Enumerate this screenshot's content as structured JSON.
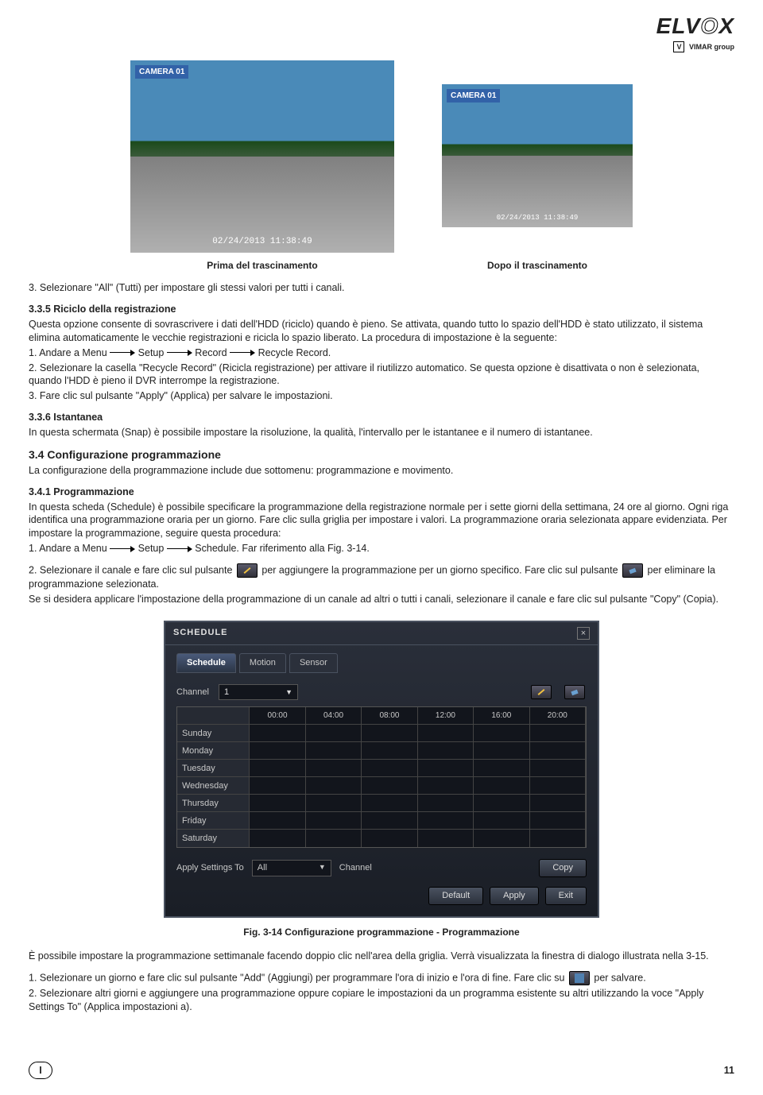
{
  "logo": {
    "main_a": "ELV",
    "main_o": "O",
    "main_b": "X",
    "sub_box": "V",
    "sub": "VIMAR group"
  },
  "camera": {
    "tag": "CAMERA 01",
    "ts": "02/24/2013  11:38:49",
    "cap_before": "Prima del trascinamento",
    "cap_after": "Dopo il trascinamento"
  },
  "p3": "3. Selezionare \"All\" (Tutti) per impostare gli stessi valori per tutti i canali.",
  "s335": {
    "title": "3.3.5 Riciclo della registrazione",
    "p1": "Questa opzione consente di sovrascrivere i dati dell'HDD (riciclo) quando è pieno. Se attivata, quando tutto lo spazio dell'HDD è stato utilizzato, il sistema elimina automaticamente le vecchie registrazioni e ricicla lo spazio liberato. La procedura di impostazione è la seguente:",
    "step1_a": "1. Andare a Menu",
    "step1_b": "Setup",
    "step1_c": "Record",
    "step1_d": "Recycle Record.",
    "step2": "2. Selezionare la casella \"Recycle Record\" (Ricicla registrazione) per attivare il riutilizzo automatico. Se questa opzione è disattivata o non è selezionata, quando l'HDD è pieno il DVR interrompe la registrazione.",
    "step3": "3. Fare clic sul pulsante \"Apply\" (Applica) per salvare le impostazioni."
  },
  "s336": {
    "title": "3.3.6 Istantanea",
    "p": "In questa schermata (Snap) è possibile impostare la risoluzione, la qualità, l'intervallo per le istantanee e il numero di istantanee."
  },
  "s34": {
    "title": "3.4  Configurazione programmazione",
    "p": "La configurazione della programmazione include due sottomenu: programmazione e movimento."
  },
  "s341": {
    "title": "3.4.1 Programmazione",
    "p1": "In questa scheda (Schedule) è possibile specificare la programmazione della registrazione normale per i sette giorni della settimana, 24 ore al giorno. Ogni riga identifica una programmazione oraria per un giorno. Fare clic sulla griglia per impostare i valori. La programmazione oraria selezionata appare evidenziata. Per impostare la programmazione, seguire questa procedura:",
    "step1_a": "1. Andare a Menu",
    "step1_b": "Setup",
    "step1_c": "Schedule. Far riferimento alla Fig. 3-14.",
    "step2_a": "2. Selezionare il canale e fare clic sul pulsante",
    "step2_b": "per aggiungere la programmazione per un giorno specifico. Fare clic sul pulsante",
    "step2_c": "per eliminare la programmazione selezionata.",
    "step2_d": "Se si desidera applicare l'impostazione della programmazione di un canale ad altri o tutti i canali, selezionare il canale e fare clic sul pulsante \"Copy\" (Copia)."
  },
  "sched": {
    "title": "SCHEDULE",
    "tabs": [
      "Schedule",
      "Motion",
      "Sensor"
    ],
    "channel_label": "Channel",
    "channel_val": "1",
    "hours": [
      "00:00",
      "04:00",
      "08:00",
      "12:00",
      "16:00",
      "20:00"
    ],
    "days": [
      "Sunday",
      "Monday",
      "Tuesday",
      "Wednesday",
      "Thursday",
      "Friday",
      "Saturday"
    ],
    "apply_label": "Apply Settings To",
    "apply_val": "All",
    "ch_label2": "Channel",
    "copy": "Copy",
    "default": "Default",
    "apply": "Apply",
    "exit": "Exit"
  },
  "fig": "Fig. 3-14 Configurazione programmazione - Programmazione",
  "after": {
    "p1": "È possibile impostare la programmazione settimanale facendo doppio clic nell'area della griglia. Verrà visualizzata la finestra di dialogo illustrata nella 3-15.",
    "step1_a": "1. Selezionare un giorno e fare clic sul pulsante \"Add\" (Aggiungi) per programmare l'ora di inizio e l'ora di fine. Fare clic su",
    "step1_b": "per salvare.",
    "step2": "2. Selezionare altri giorni e aggiungere una programmazione oppure copiare le impostazioni da un programma esistente su altri utilizzando la voce \"Apply Settings To\" (Applica impostazioni a)."
  },
  "footer": {
    "lang": "I",
    "page": "11"
  }
}
